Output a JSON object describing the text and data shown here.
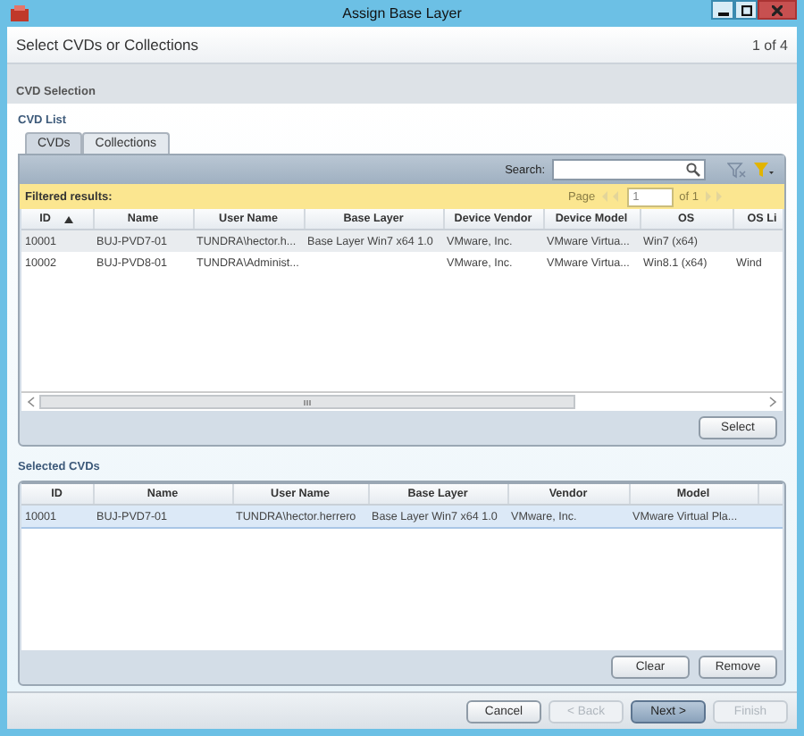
{
  "window": {
    "title": "Assign Base Layer"
  },
  "header": {
    "title": "Select CVDs or Collections",
    "step": "1 of 4"
  },
  "section": {
    "title": "CVD Selection"
  },
  "cvd_list": {
    "title": "CVD List",
    "tabs": [
      {
        "label": "CVDs",
        "selected": true
      },
      {
        "label": "Collections",
        "selected": false
      }
    ],
    "search": {
      "label": "Search:"
    },
    "filter_label": "Filtered results:",
    "pager": {
      "label": "Page",
      "page": "1",
      "of": "of 1"
    },
    "columns": [
      {
        "label": "ID",
        "sorted": true
      },
      {
        "label": "Name",
        "sorted": false
      },
      {
        "label": "User Name",
        "sorted": false
      },
      {
        "label": "Base Layer",
        "sorted": false
      },
      {
        "label": "Device Vendor",
        "sorted": false
      },
      {
        "label": "Device Model",
        "sorted": false
      },
      {
        "label": "OS",
        "sorted": false
      },
      {
        "label": "OS Li",
        "sorted": false
      }
    ],
    "rows": [
      {
        "selected": true,
        "cells": [
          "10001",
          "BUJ-PVD7-01",
          "TUNDRA\\hector.h...",
          "Base Layer Win7 x64 1.0",
          "VMware, Inc.",
          "VMware Virtua...",
          "Win7 (x64)",
          ""
        ]
      },
      {
        "selected": false,
        "cells": [
          "10002",
          "BUJ-PVD8-01",
          "TUNDRA\\Administ...",
          "",
          "VMware, Inc.",
          "VMware Virtua...",
          "Win8.1 (x64)",
          "Wind"
        ]
      }
    ],
    "buttons": [
      {
        "label": "Select",
        "disabled": false,
        "primary": false
      }
    ]
  },
  "selected_cvds": {
    "title": "Selected CVDs",
    "columns": [
      {
        "label": "ID",
        "sorted": false
      },
      {
        "label": "Name",
        "sorted": false
      },
      {
        "label": "User Name",
        "sorted": false
      },
      {
        "label": "Base Layer",
        "sorted": false
      },
      {
        "label": "Vendor",
        "sorted": false
      },
      {
        "label": "Model",
        "sorted": false
      }
    ],
    "rows": [
      {
        "selected": true,
        "cells": [
          "10001",
          "BUJ-PVD7-01",
          "TUNDRA\\hector.herrero",
          "Base Layer Win7 x64 1.0",
          "VMware, Inc.",
          "VMware Virtual Pla..."
        ]
      }
    ],
    "buttons": [
      {
        "label": "Clear",
        "disabled": false,
        "primary": false
      },
      {
        "label": "Remove",
        "disabled": false,
        "primary": false
      }
    ]
  },
  "footer_buttons": [
    {
      "label": "Cancel",
      "disabled": false,
      "primary": false
    },
    {
      "label": "< Back",
      "disabled": true,
      "primary": false
    },
    {
      "label": "Next >",
      "disabled": false,
      "primary": true
    },
    {
      "label": "Finish",
      "disabled": true,
      "primary": false
    }
  ]
}
